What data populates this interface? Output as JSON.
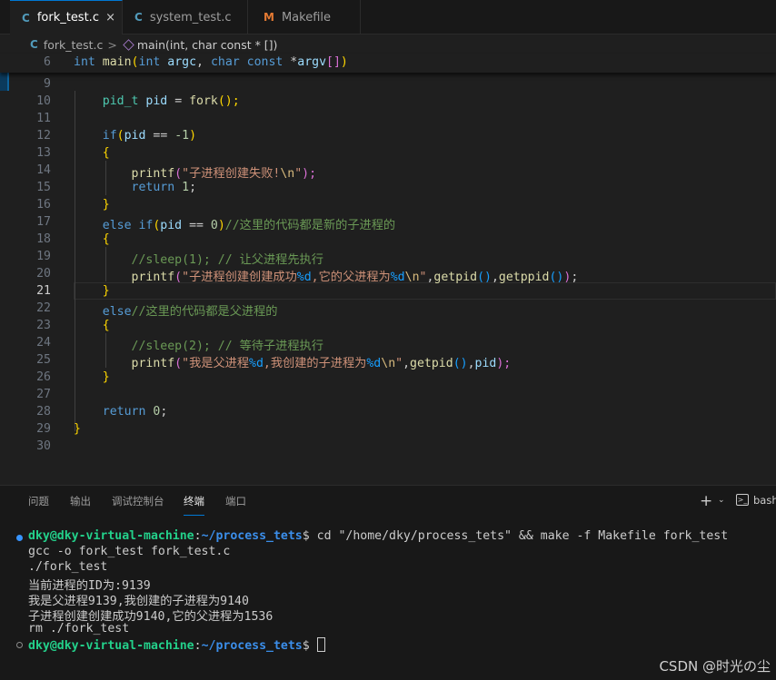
{
  "tabs": [
    {
      "icon": "C",
      "label": "fork_test.c",
      "close": "×"
    },
    {
      "icon": "C",
      "label": "system_test.c"
    },
    {
      "icon": "M",
      "label": "Makefile"
    }
  ],
  "breadcrumb": {
    "file_icon": "C",
    "file": "fork_test.c",
    "separator": ">",
    "symbol": "main(int, char const * [])"
  },
  "editor": {
    "sticky": {
      "number": "6",
      "code": "int main(int argc, char const *argv[])"
    },
    "current_line": "21",
    "line_numbers": [
      "9",
      "10",
      "11",
      "12",
      "13",
      "14",
      "15",
      "16",
      "17",
      "18",
      "19",
      "20",
      "21",
      "22",
      "23",
      "24",
      "25",
      "26",
      "27",
      "28",
      "29",
      "30"
    ],
    "code": {
      "l10a": "pid_t",
      "l10b": "pid",
      "l10c": " = ",
      "l10d": "fork",
      "l10e": "();",
      "l12a": "if",
      "l12b": "(",
      "l12c": "pid",
      "l12d": " == ",
      "l12e": "-1",
      "l12f": ")",
      "l13": "{",
      "l14a": "printf",
      "l14b": "(",
      "l14c": "\"子进程创建失败!",
      "l14d": "\\n",
      "l14e": "\"",
      "l14f": ");",
      "l15a": "return",
      "l15b": "1",
      "l15c": ";",
      "l16": "}",
      "l17a": "else if",
      "l17b": "(",
      "l17c": "pid",
      "l17d": " == ",
      "l17e": "0",
      "l17f": ")",
      "l17g": "//这里的代码都是新的子进程的",
      "l18": "{",
      "l19": "//sleep(1); // 让父进程先执行",
      "l20a": "printf",
      "l20b": "(",
      "l20c": "\"子进程创建创建成功",
      "l20d": "%d",
      "l20e": ",它的父进程为",
      "l20f": "%d",
      "l20g": "\\n",
      "l20h": "\"",
      "l20i": ",",
      "l20j": "getpid",
      "l20k": "()",
      "l20l": ",",
      "l20m": "getppid",
      "l20n": "()",
      "l20o": ")",
      "l20p": ";",
      "l21": "}",
      "l22a": "else",
      "l22b": "//这里的代码都是父进程的",
      "l23": "{",
      "l24": "//sleep(2); // 等待子进程执行",
      "l25a": "printf",
      "l25b": "(",
      "l25c": "\"我是父进程",
      "l25d": "%d",
      "l25e": ",我创建的子进程为",
      "l25f": "%d",
      "l25g": "\\n",
      "l25h": "\"",
      "l25i": ",",
      "l25j": "getpid",
      "l25k": "()",
      "l25l": ",",
      "l25m": "pid",
      "l25n": ");",
      "l26": "}",
      "l28a": "return",
      "l28b": "0",
      "l28c": ";",
      "l29": "}"
    }
  },
  "panel": {
    "tabs": [
      "问题",
      "输出",
      "调试控制台",
      "终端",
      "端口"
    ],
    "active_tab": "终端",
    "new_terminal": "+",
    "dropdown": "⌄",
    "shell_icon": ">_",
    "shell": "bash"
  },
  "terminal": {
    "user": "dky@dky-virtual-machine",
    "colon": ":",
    "path": "~/process_tets",
    "dollar": "$",
    "command": " cd \"/home/dky/process_tets\" && make -f Makefile fork_test",
    "output": [
      "gcc -o fork_test fork_test.c",
      "./fork_test",
      "当前进程的ID为:9139",
      "我是父进程9139,我创建的子进程为9140",
      "子进程创建创建成功9140,它的父进程为1536",
      "rm ./fork_test"
    ]
  },
  "watermark": "CSDN @时光の尘",
  "colors": {
    "accent": "#0078d4",
    "prompt_green": "#23d18b",
    "prompt_blue": "#3b8eea",
    "keyword": "#569cd6",
    "string": "#ce9178",
    "comment": "#6a9955"
  }
}
